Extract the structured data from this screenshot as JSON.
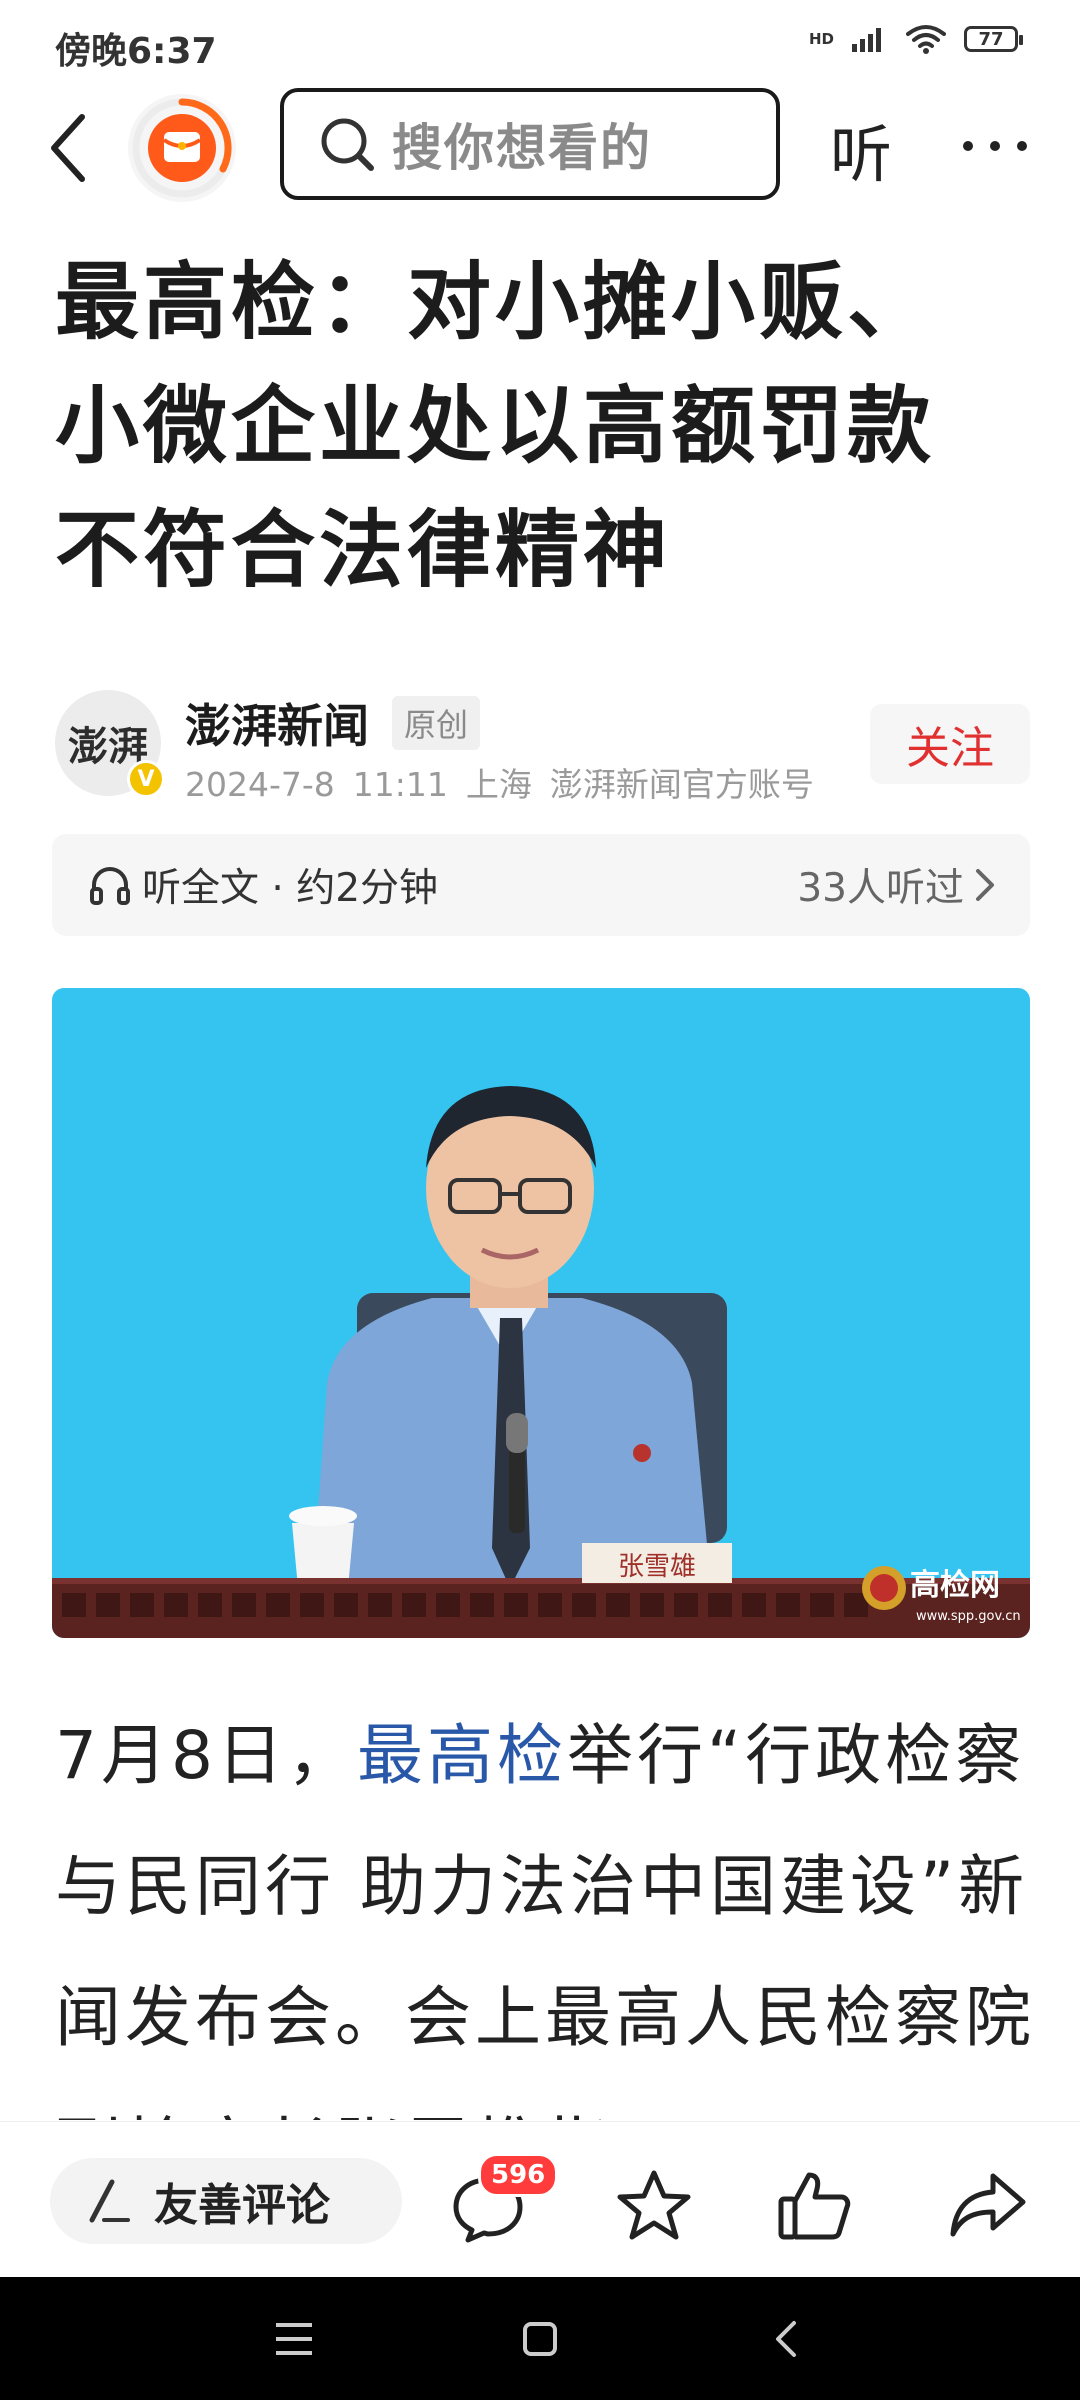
{
  "status_bar": {
    "time": "傍晚6:37",
    "network": "HD",
    "battery": "77"
  },
  "top_nav": {
    "search_placeholder": "搜你想看的",
    "listen_label": "听"
  },
  "article": {
    "title_lines": [
      "最高检：对小摊小贩、",
      "小微企业处以高额罚款",
      "不符合法律精神"
    ],
    "author": {
      "name": "澎湃新闻",
      "avatar_text": "澎湃",
      "badge": "原创",
      "date": "2024-7-8",
      "time": "11:11",
      "location": "上海",
      "account_type": "澎湃新闻官方账号",
      "verified_mark": "V"
    },
    "follow_label": "关注",
    "listen_bar": {
      "label": "听全文 · 约2分钟",
      "count": "33人听过"
    },
    "photo": {
      "nameplate": "张雪雄",
      "watermark": "高检网",
      "watermark_url": "www.spp.gov.cn"
    },
    "body": {
      "prefix": "7月8日，",
      "link": "最高检",
      "text": "举行“行政检察与民同行 助力法治中国建设”新闻发布会。会上最高人民检察院副检察长张雪樵指"
    }
  },
  "bottom_bar": {
    "comment_label": "友善评论",
    "comment_count": "596"
  },
  "colors": {
    "accent_red": "#e03030",
    "link_blue": "#2a58a8",
    "photo_bg": "#35c4ef"
  }
}
